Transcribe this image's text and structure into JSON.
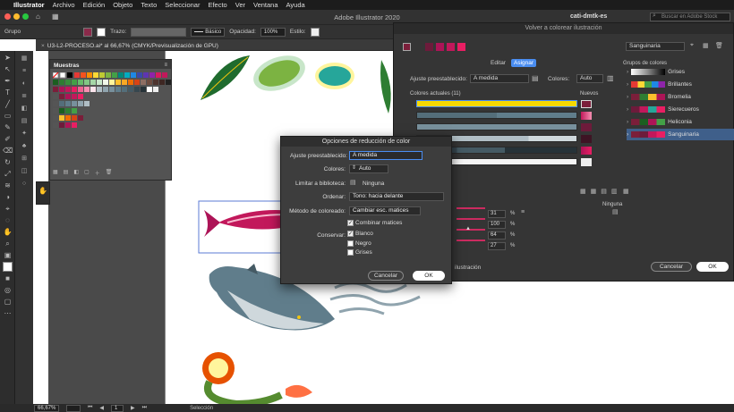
{
  "menubar": {
    "app": "Illustrator",
    "items": [
      "Archivo",
      "Edición",
      "Objeto",
      "Texto",
      "Seleccionar",
      "Efecto",
      "Ver",
      "Ventana",
      "Ayuda"
    ]
  },
  "app_title": "Adobe Illustrator 2020",
  "workspace": "cati-dmtk-es",
  "search_placeholder": "Buscar en Adobe Stock",
  "control": {
    "selection": "Grupo",
    "stroke_label": "Trazo:",
    "stroke_style": "Básico",
    "opacity_label": "Opacidad:",
    "opacity_value": "100%",
    "style_label": "Estilo:"
  },
  "document_tab": "U3-L2-PROCESO.ai* al 66,67% (CMYK/Previsualización de GPU)",
  "status": {
    "zoom": "66,67%",
    "page": "1",
    "tool": "Selección"
  },
  "muestras": {
    "title": "Muestras"
  },
  "dialog": {
    "title": "Opciones de reducción de color",
    "preset_label": "Ajuste preestablecido:",
    "preset_value": "A medida",
    "colors_label": "Colores:",
    "colors_value": "Auto",
    "library_label": "Limitar a biblioteca:",
    "library_value": "Ninguna",
    "sort_label": "Ordenar:",
    "sort_value": "Tono: hacia delante",
    "method_label": "Método de coloreado:",
    "method_value": "Cambiar esc. matices",
    "combine_label": "Combinar matices",
    "preserve_label": "Conservar:",
    "white_label": "Blanco",
    "black_label": "Negro",
    "grays_label": "Grises",
    "cancel": "Cancelar",
    "ok": "OK"
  },
  "recolor": {
    "title": "Volver a colorear ilustración",
    "group_name": "Sanguinaria",
    "tab_edit": "Editar",
    "tab_assign": "Asignar",
    "preset_label": "Ajuste preestablecido:",
    "preset_value": "A medida",
    "colors_label": "Colores:",
    "colors_value": "Auto",
    "current_colors": "Colores actuales (11)",
    "new_label": "Nuevos",
    "none_label": "Ninguna",
    "values": [
      "31",
      "100",
      "64",
      "27"
    ],
    "percent": "%",
    "recolor_label": "ilustración",
    "groups_title": "Grupos de colores",
    "groups": [
      "Grises",
      "Brillantes",
      "Bromelia",
      "Sierecueros",
      "Heliconia",
      "Sanguinaria"
    ],
    "cancel": "Cancelar",
    "ok": "OK"
  },
  "colors": {
    "accent": "#4a8df0",
    "yellow": "#f5d800",
    "magenta": "#c2185b"
  }
}
